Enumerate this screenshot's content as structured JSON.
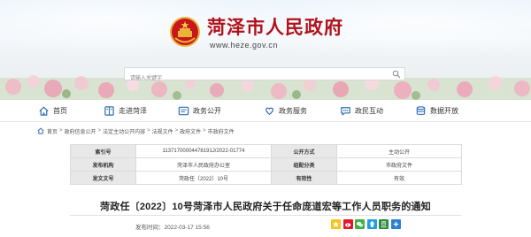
{
  "site": {
    "title": "菏泽市人民政府",
    "url": "www.heze.gov.cn"
  },
  "search": {
    "placeholder": "请输入关键字"
  },
  "nav": {
    "items": [
      {
        "label": "首页",
        "icon": "home-icon"
      },
      {
        "label": "走进菏泽",
        "icon": "book-icon"
      },
      {
        "label": "政务公开",
        "icon": "document-icon"
      },
      {
        "label": "政务服务",
        "icon": "heart-hands-icon"
      },
      {
        "label": "政民互动",
        "icon": "chat-icon"
      },
      {
        "label": "数据开放",
        "icon": "database-icon"
      }
    ]
  },
  "breadcrumb": {
    "items": [
      "首页",
      "政府信息公开",
      "法定主动公开内容",
      "法规文件",
      "政府文件",
      "市政府文件"
    ],
    "separator": ">"
  },
  "info": {
    "rows": [
      [
        {
          "label": "索引号",
          "value": "11371700004478191J/2022-01774"
        },
        {
          "label": "公开方式",
          "value": "主动公开"
        }
      ],
      [
        {
          "label": "发布机构",
          "value": "菏泽市人民政府办公室"
        },
        {
          "label": "组配分类",
          "value": "市政府文件"
        }
      ],
      [
        {
          "label": "发文文号",
          "value": "菏政任〔2022〕10号"
        },
        {
          "label": "有效性",
          "value": "有效"
        }
      ]
    ]
  },
  "article": {
    "title": "菏政任〔2022〕10号菏泽市人民政府关于任命庞道宏等工作人员职务的通知",
    "publish_label": "发布时间：",
    "publish_time": "2022-03-17 15:56"
  },
  "colors": {
    "brand_red": "#b0121b",
    "nav_icon_blue": "#2f6fb5",
    "table_label_bg": "#e8e8e8"
  },
  "share": {
    "buttons": [
      {
        "icon": "qzone-share-icon",
        "color": "#f6c31a"
      },
      {
        "icon": "weibo-share-icon",
        "color": "#e6162d"
      },
      {
        "icon": "wechat-share-icon",
        "color": "#3fb13e"
      },
      {
        "icon": "qq-share-icon",
        "color": "#1e9fe3"
      },
      {
        "icon": "douban-share-icon",
        "color": "#2a8c3a"
      },
      {
        "icon": "more-share-icon",
        "color": "#2d7fd0"
      }
    ]
  }
}
